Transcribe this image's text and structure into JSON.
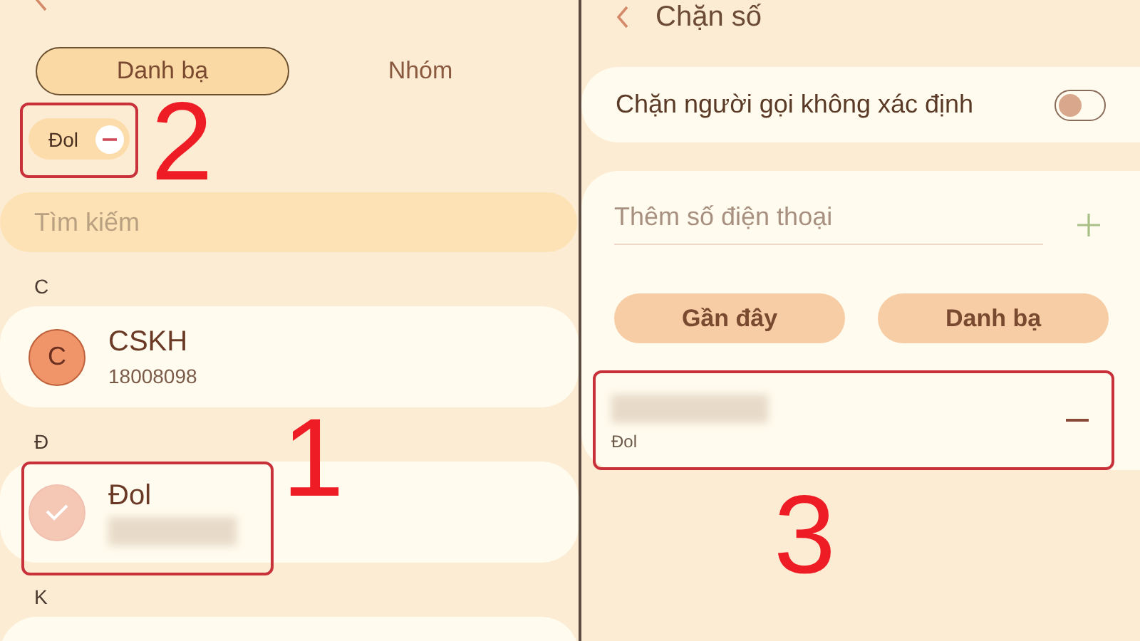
{
  "left": {
    "tabs": [
      {
        "label": "Danh bạ",
        "selected": true
      },
      {
        "label": "Nhóm",
        "selected": false
      }
    ],
    "selected_chips": [
      {
        "label": "Đol"
      }
    ],
    "search": {
      "placeholder": "Tìm kiếm"
    },
    "sections": [
      {
        "letter": "C",
        "contacts": [
          {
            "avatar": "C",
            "name": "CSKH",
            "number": "18008098",
            "number_hidden": false,
            "selected": false
          }
        ]
      },
      {
        "letter": "Đ",
        "contacts": [
          {
            "name": "Đol",
            "number_hidden": true,
            "selected": true
          }
        ]
      },
      {
        "letter": "K"
      }
    ],
    "callouts": [
      "2",
      "1"
    ]
  },
  "right": {
    "header": {
      "title": "Chặn số"
    },
    "block_unknown": {
      "label": "Chặn người gọi không xác định",
      "on": false
    },
    "add_number": {
      "placeholder": "Thêm số điện thoại"
    },
    "buttons": [
      "Gần đây",
      "Danh bạ"
    ],
    "blocked": [
      {
        "name": "Đol",
        "number_hidden": true
      }
    ],
    "callouts": [
      "3"
    ]
  }
}
